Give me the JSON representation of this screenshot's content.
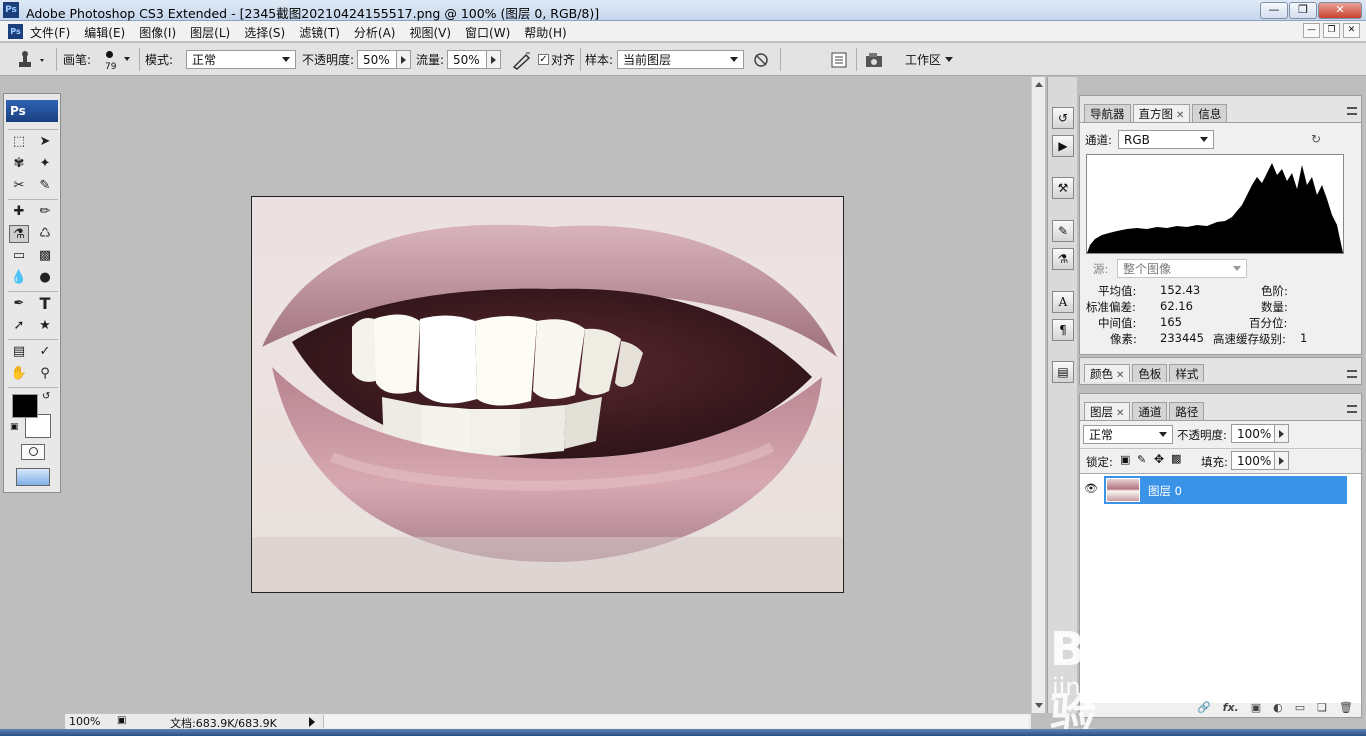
{
  "window": {
    "title": "Adobe Photoshop CS3 Extended - [2345截图20210424155517.png @ 100% (图层 0, RGB/8)]",
    "ps_logo": "Ps"
  },
  "menu": [
    "文件(F)",
    "编辑(E)",
    "图像(I)",
    "图层(L)",
    "选择(S)",
    "滤镜(T)",
    "分析(A)",
    "视图(V)",
    "窗口(W)",
    "帮助(H)"
  ],
  "options": {
    "brush_label": "画笔:",
    "brush_size": "79",
    "mode_label": "模式:",
    "mode_value": "正常",
    "opacity_label": "不透明度:",
    "opacity_value": "50%",
    "flow_label": "流量:",
    "flow_value": "50%",
    "aligned_label": "对齐",
    "aligned_checked": true,
    "sample_label": "样本:",
    "sample_value": "当前图层",
    "workspace_label": "工作区"
  },
  "toolbox": {
    "header": "Ps"
  },
  "status": {
    "zoom": "100%",
    "doc_info": "文档:683.9K/683.9K"
  },
  "histogram_panel": {
    "tabs": [
      "导航器",
      "直方图",
      "信息"
    ],
    "active_tab": 1,
    "channel_label": "通道:",
    "channel_value": "RGB",
    "source_label": "源:",
    "source_value": "整个图像",
    "stats": {
      "mean_label": "平均值:",
      "mean": "152.43",
      "stddev_label": "标准偏差:",
      "stddev": "62.16",
      "median_label": "中间值:",
      "median": "165",
      "pixels_label": "像素:",
      "pixels": "233445",
      "level_label": "色阶:",
      "count_label": "数量:",
      "percentile_label": "百分位:",
      "cache_label": "高速缓存级别:",
      "cache": "1"
    }
  },
  "color_panel": {
    "tabs": [
      "颜色",
      "色板",
      "样式"
    ]
  },
  "layers_panel": {
    "tabs": [
      "图层",
      "通道",
      "路径"
    ],
    "blend_mode": "正常",
    "opacity_label": "不透明度:",
    "opacity_value": "100%",
    "lock_label": "锁定:",
    "fill_label": "填充:",
    "fill_value": "100%",
    "layers": [
      {
        "name": "图层 0",
        "visible": true,
        "selected": true
      }
    ],
    "footer_fx": "fx."
  },
  "watermark": {
    "brand": "Bai du 经验",
    "url": "jingyan.baidu.com"
  },
  "colors": {
    "selection": "#3b93e8",
    "foreground": "#000000",
    "background": "#ffffff"
  }
}
